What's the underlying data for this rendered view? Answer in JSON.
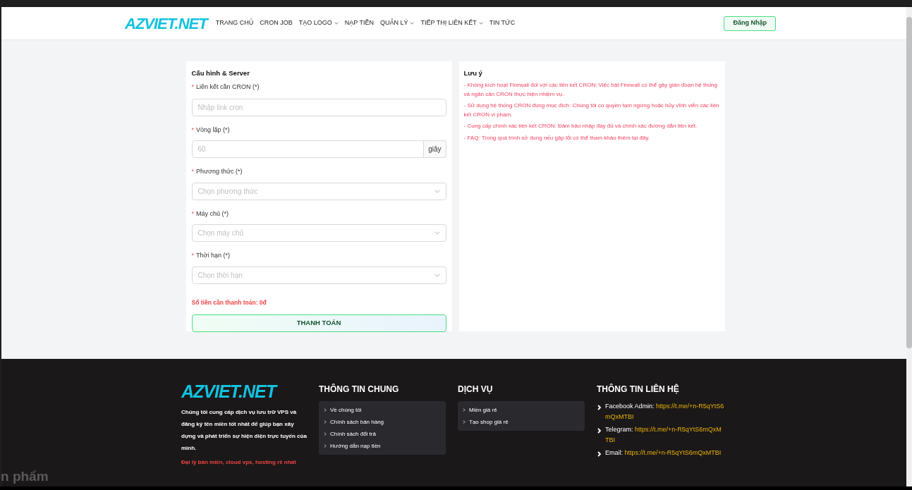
{
  "header": {
    "logo": "AZVIET.NET",
    "nav": [
      {
        "label": "TRANG CHỦ",
        "dropdown": false
      },
      {
        "label": "CRON JOB",
        "dropdown": false
      },
      {
        "label": "TẠO LOGO",
        "dropdown": true
      },
      {
        "label": "NẠP TIỀN",
        "dropdown": false
      },
      {
        "label": "QUẢN LÝ",
        "dropdown": true
      },
      {
        "label": "TIẾP THỊ LIÊN KẾT",
        "dropdown": true
      },
      {
        "label": "TIN TỨC",
        "dropdown": false
      }
    ],
    "login": "Đăng Nhập"
  },
  "form": {
    "title": "Cấu hình & Server",
    "fields": [
      {
        "kind": "input",
        "required": "*",
        "label": "Liên kết cần CRON (*)",
        "placeholder": "Nhập link cron"
      },
      {
        "kind": "addon",
        "required": "*",
        "label": "Vòng lặp (*)",
        "placeholder": "60",
        "addon": "giây"
      },
      {
        "kind": "select",
        "required": "*",
        "label": "Phương thức (*)",
        "placeholder": "Chọn phương thức"
      },
      {
        "kind": "select",
        "required": "*",
        "label": "Máy chủ (*)",
        "placeholder": "Chọn máy chủ"
      },
      {
        "kind": "select",
        "required": "*",
        "label": "Thời hạn (*)",
        "placeholder": "Chọn thời hạn"
      }
    ],
    "total": "Số tiền cần thanh toán: 0đ",
    "submit": "THANH TOÁN"
  },
  "notes": {
    "title": "Lưu ý",
    "items": [
      "- Không kích hoạt Firewall đối với các liên kết CRON: Việc bật Firewall có thể gây gián đoạn hệ thống và ngăn cản CRON thực hiện nhiệm vụ.",
      "- Sử dụng hệ thống CRON đúng mục đích: Chúng tôi có quyền tạm ngừng hoặc hủy vĩnh viễn các liên kết CRON vi phạm.",
      "- Cung cấp chính xác liên kết CRON: Đảm bảo nhập đầy đủ và chính xác đường dẫn liên kết.",
      "- FAQ: Trong quá trình sử dụng nếu gặp lỗi có thể tham khảo thêm tại đây."
    ]
  },
  "footer": {
    "logo": "AZVIET.NET",
    "about": "Chúng tôi cung cấp dịch vụ lưu trữ VPS và đăng ký tên miền tốt nhất để giúp bạn xây dựng và phát triển sự hiện diện trực tuyến của mình.",
    "tagline": "Đại lý bán miền, cloud vps, hosting rẻ nhất",
    "columns": [
      {
        "title": "THÔNG TIN CHUNG",
        "links": [
          "Về chúng tôi",
          "Chính sách bán hàng",
          "Chính sách đổi trả",
          "Hướng dẫn nạp tiền"
        ]
      },
      {
        "title": "DỊCH VỤ",
        "links": [
          "Miền giá rẻ",
          "Tạo shop giá rẻ"
        ]
      }
    ],
    "contact": {
      "title": "THÔNG TIN LIÊN HỆ",
      "items": [
        {
          "label": "Facebook Admin:",
          "link": "https://t.me/+n-R5qYtS6mQxMTBI"
        },
        {
          "label": "Telegram:",
          "link": "https://t.me/+n-R5qYtS6mQxMTBI"
        },
        {
          "label": "Email:",
          "link": "https://t.me/+n-R5qYtS6mQxMTBI"
        }
      ]
    }
  },
  "overlay_text": "n phẩm"
}
